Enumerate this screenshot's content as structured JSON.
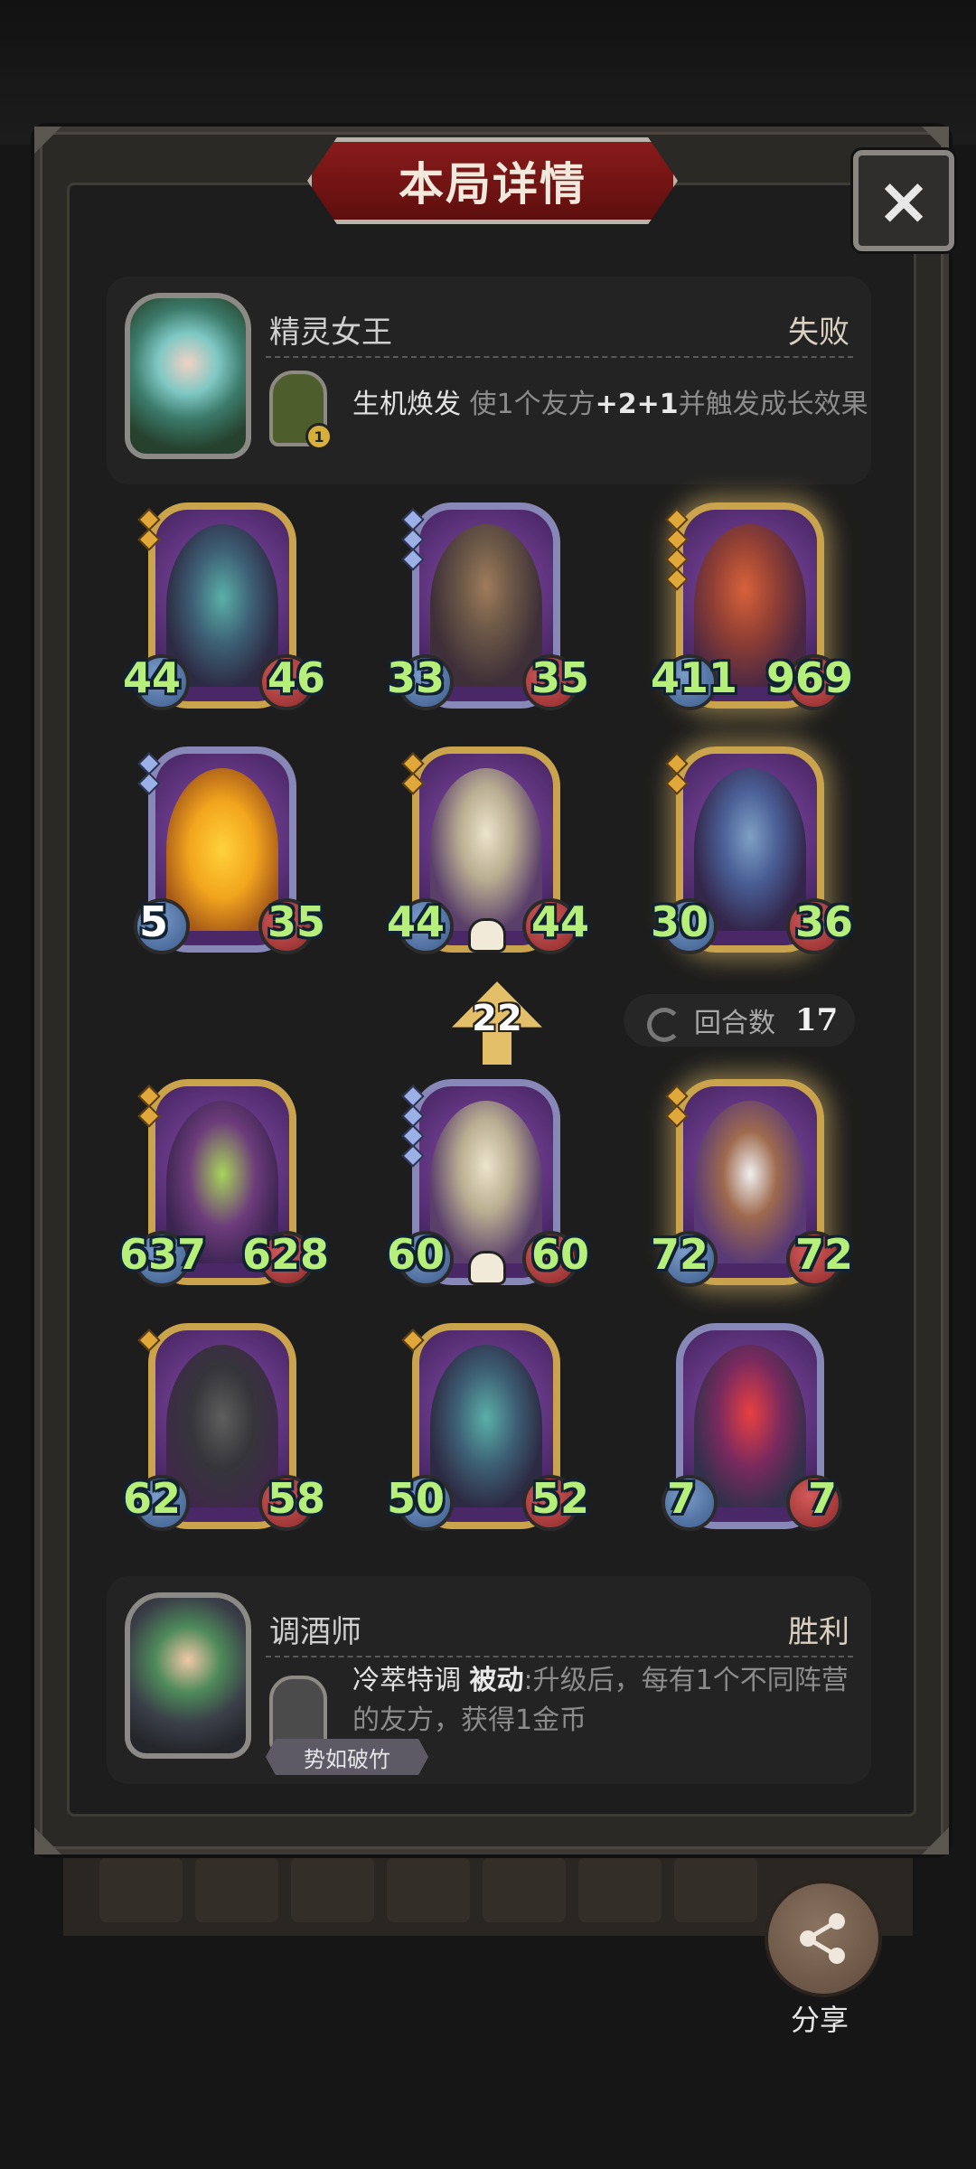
{
  "title": "本局详情",
  "close_icon": "×",
  "opponent": {
    "name": "精灵女王",
    "result": "失败",
    "skill_name": "生机焕发",
    "skill_desc_pre": "使1个友方",
    "skill_highlight": "+2+1",
    "skill_desc_post": "并触发成长效果",
    "skill_level": "1"
  },
  "round": {
    "tier": "22",
    "label": "回合数",
    "value": "17"
  },
  "enemy_cards": [
    {
      "atk": "44",
      "hp": "46",
      "level": 2
    },
    {
      "atk": "33",
      "hp": "35",
      "level": 3
    },
    {
      "atk": "411",
      "hp": "969",
      "level": 4
    },
    {
      "atk": "5",
      "hp": "35",
      "level": 2
    },
    {
      "atk": "44",
      "hp": "44",
      "level": 2
    },
    {
      "atk": "30",
      "hp": "36",
      "level": 2
    }
  ],
  "player_cards": [
    {
      "atk": "637",
      "hp": "628",
      "level": 2
    },
    {
      "atk": "60",
      "hp": "60",
      "level": 4
    },
    {
      "atk": "72",
      "hp": "72",
      "level": 2
    },
    {
      "atk": "62",
      "hp": "58",
      "level": 1
    },
    {
      "atk": "50",
      "hp": "52",
      "level": 1
    },
    {
      "atk": "7",
      "hp": "7",
      "level": 0
    }
  ],
  "player": {
    "name": "调酒师",
    "result": "胜利",
    "skill_name": "冷萃特调",
    "skill_tag": "被动",
    "skill_desc_line1": ":升级后，每有1个不同阵营",
    "skill_desc_line2": "的友方，获得1金币",
    "title_tag": "势如破竹"
  },
  "share": {
    "label": "分享",
    "icon": "share-icon"
  },
  "colors": {
    "accent": "#8a1b1b",
    "stat_green": "#b6f07a",
    "gold_frame": "#c9a44c",
    "silver_frame": "#8787b8"
  }
}
